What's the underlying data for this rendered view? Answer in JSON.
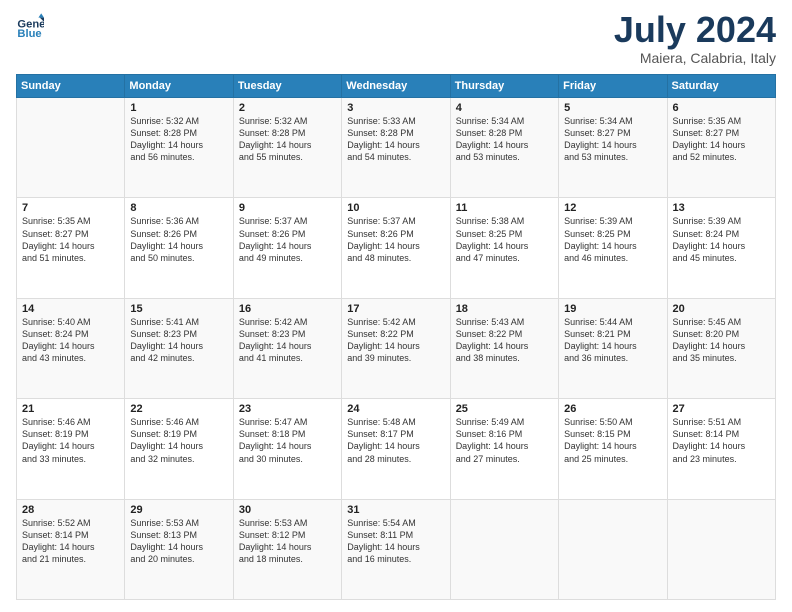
{
  "header": {
    "logo_line1": "General",
    "logo_line2": "Blue",
    "month": "July 2024",
    "location": "Maiera, Calabria, Italy"
  },
  "weekdays": [
    "Sunday",
    "Monday",
    "Tuesday",
    "Wednesday",
    "Thursday",
    "Friday",
    "Saturday"
  ],
  "weeks": [
    [
      {
        "day": null,
        "info": null
      },
      {
        "day": "1",
        "info": "Sunrise: 5:32 AM\nSunset: 8:28 PM\nDaylight: 14 hours\nand 56 minutes."
      },
      {
        "day": "2",
        "info": "Sunrise: 5:32 AM\nSunset: 8:28 PM\nDaylight: 14 hours\nand 55 minutes."
      },
      {
        "day": "3",
        "info": "Sunrise: 5:33 AM\nSunset: 8:28 PM\nDaylight: 14 hours\nand 54 minutes."
      },
      {
        "day": "4",
        "info": "Sunrise: 5:34 AM\nSunset: 8:28 PM\nDaylight: 14 hours\nand 53 minutes."
      },
      {
        "day": "5",
        "info": "Sunrise: 5:34 AM\nSunset: 8:27 PM\nDaylight: 14 hours\nand 53 minutes."
      },
      {
        "day": "6",
        "info": "Sunrise: 5:35 AM\nSunset: 8:27 PM\nDaylight: 14 hours\nand 52 minutes."
      }
    ],
    [
      {
        "day": "7",
        "info": "Sunrise: 5:35 AM\nSunset: 8:27 PM\nDaylight: 14 hours\nand 51 minutes."
      },
      {
        "day": "8",
        "info": "Sunrise: 5:36 AM\nSunset: 8:26 PM\nDaylight: 14 hours\nand 50 minutes."
      },
      {
        "day": "9",
        "info": "Sunrise: 5:37 AM\nSunset: 8:26 PM\nDaylight: 14 hours\nand 49 minutes."
      },
      {
        "day": "10",
        "info": "Sunrise: 5:37 AM\nSunset: 8:26 PM\nDaylight: 14 hours\nand 48 minutes."
      },
      {
        "day": "11",
        "info": "Sunrise: 5:38 AM\nSunset: 8:25 PM\nDaylight: 14 hours\nand 47 minutes."
      },
      {
        "day": "12",
        "info": "Sunrise: 5:39 AM\nSunset: 8:25 PM\nDaylight: 14 hours\nand 46 minutes."
      },
      {
        "day": "13",
        "info": "Sunrise: 5:39 AM\nSunset: 8:24 PM\nDaylight: 14 hours\nand 45 minutes."
      }
    ],
    [
      {
        "day": "14",
        "info": "Sunrise: 5:40 AM\nSunset: 8:24 PM\nDaylight: 14 hours\nand 43 minutes."
      },
      {
        "day": "15",
        "info": "Sunrise: 5:41 AM\nSunset: 8:23 PM\nDaylight: 14 hours\nand 42 minutes."
      },
      {
        "day": "16",
        "info": "Sunrise: 5:42 AM\nSunset: 8:23 PM\nDaylight: 14 hours\nand 41 minutes."
      },
      {
        "day": "17",
        "info": "Sunrise: 5:42 AM\nSunset: 8:22 PM\nDaylight: 14 hours\nand 39 minutes."
      },
      {
        "day": "18",
        "info": "Sunrise: 5:43 AM\nSunset: 8:22 PM\nDaylight: 14 hours\nand 38 minutes."
      },
      {
        "day": "19",
        "info": "Sunrise: 5:44 AM\nSunset: 8:21 PM\nDaylight: 14 hours\nand 36 minutes."
      },
      {
        "day": "20",
        "info": "Sunrise: 5:45 AM\nSunset: 8:20 PM\nDaylight: 14 hours\nand 35 minutes."
      }
    ],
    [
      {
        "day": "21",
        "info": "Sunrise: 5:46 AM\nSunset: 8:19 PM\nDaylight: 14 hours\nand 33 minutes."
      },
      {
        "day": "22",
        "info": "Sunrise: 5:46 AM\nSunset: 8:19 PM\nDaylight: 14 hours\nand 32 minutes."
      },
      {
        "day": "23",
        "info": "Sunrise: 5:47 AM\nSunset: 8:18 PM\nDaylight: 14 hours\nand 30 minutes."
      },
      {
        "day": "24",
        "info": "Sunrise: 5:48 AM\nSunset: 8:17 PM\nDaylight: 14 hours\nand 28 minutes."
      },
      {
        "day": "25",
        "info": "Sunrise: 5:49 AM\nSunset: 8:16 PM\nDaylight: 14 hours\nand 27 minutes."
      },
      {
        "day": "26",
        "info": "Sunrise: 5:50 AM\nSunset: 8:15 PM\nDaylight: 14 hours\nand 25 minutes."
      },
      {
        "day": "27",
        "info": "Sunrise: 5:51 AM\nSunset: 8:14 PM\nDaylight: 14 hours\nand 23 minutes."
      }
    ],
    [
      {
        "day": "28",
        "info": "Sunrise: 5:52 AM\nSunset: 8:14 PM\nDaylight: 14 hours\nand 21 minutes."
      },
      {
        "day": "29",
        "info": "Sunrise: 5:53 AM\nSunset: 8:13 PM\nDaylight: 14 hours\nand 20 minutes."
      },
      {
        "day": "30",
        "info": "Sunrise: 5:53 AM\nSunset: 8:12 PM\nDaylight: 14 hours\nand 18 minutes."
      },
      {
        "day": "31",
        "info": "Sunrise: 5:54 AM\nSunset: 8:11 PM\nDaylight: 14 hours\nand 16 minutes."
      },
      {
        "day": null,
        "info": null
      },
      {
        "day": null,
        "info": null
      },
      {
        "day": null,
        "info": null
      }
    ]
  ]
}
